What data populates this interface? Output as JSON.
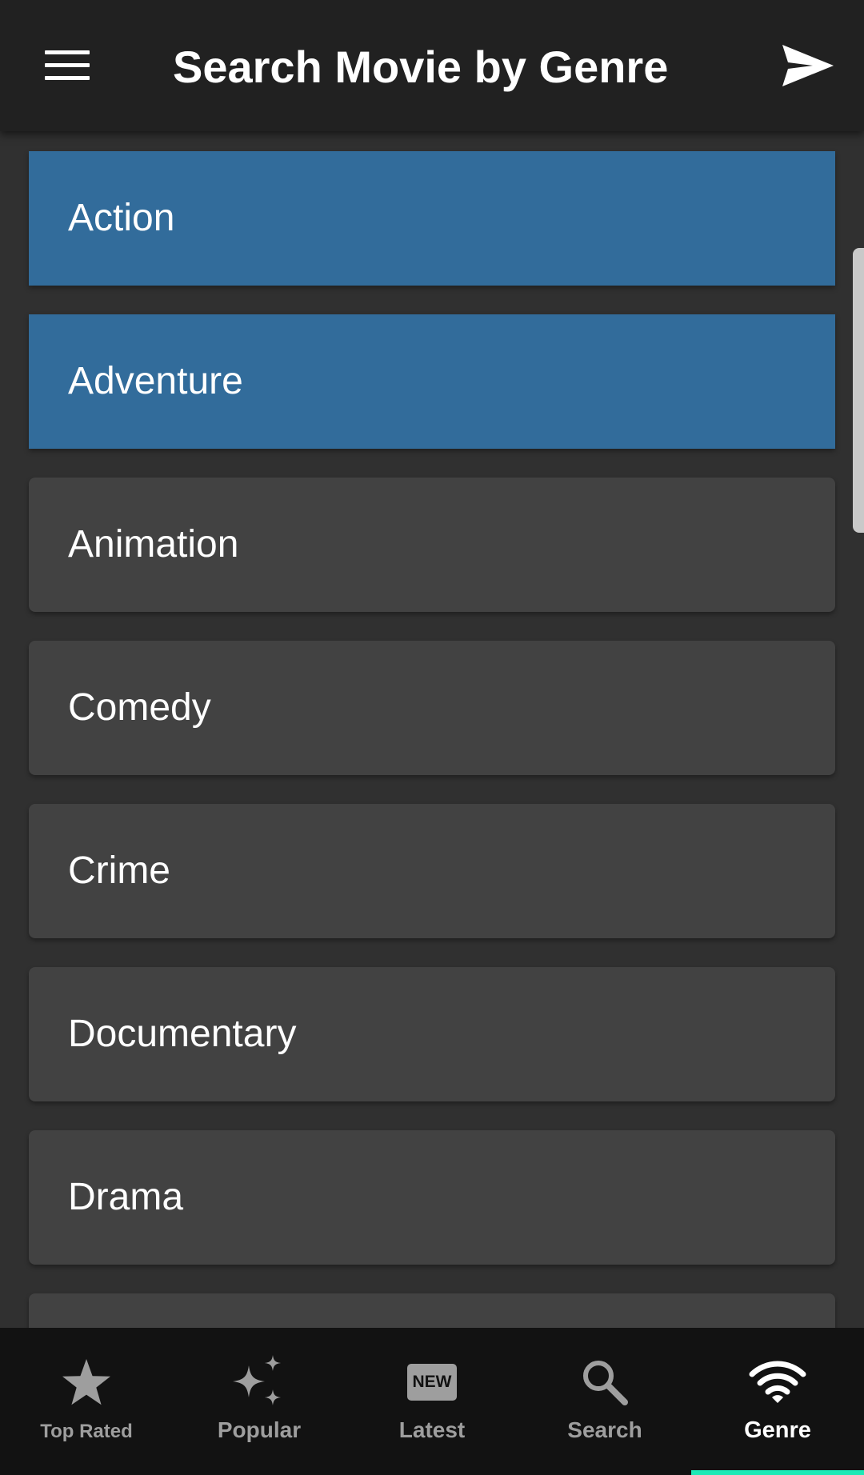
{
  "app_bar": {
    "title": "Search Movie by Genre",
    "menu_icon": "hamburger-menu-icon",
    "send_icon": "send-icon"
  },
  "genres": [
    {
      "label": "Action",
      "selected": true
    },
    {
      "label": "Adventure",
      "selected": true
    },
    {
      "label": "Animation",
      "selected": false
    },
    {
      "label": "Comedy",
      "selected": false
    },
    {
      "label": "Crime",
      "selected": false
    },
    {
      "label": "Documentary",
      "selected": false
    },
    {
      "label": "Drama",
      "selected": false
    }
  ],
  "bottom_nav": {
    "items": [
      {
        "label": "Top Rated",
        "icon": "star-icon"
      },
      {
        "label": "Popular",
        "icon": "sparkle-icon"
      },
      {
        "label": "Latest",
        "icon": "new-badge-icon",
        "badge_text": "NEW"
      },
      {
        "label": "Search",
        "icon": "search-icon"
      },
      {
        "label": "Genre",
        "icon": "wifi-icon",
        "active": true
      }
    ]
  },
  "colors": {
    "background": "#303030",
    "app_bar": "#212121",
    "card": "#424242",
    "selected_card": "#326c9b",
    "bottom_nav": "#121212",
    "accent_indicator": "#1de9b6",
    "inactive_nav": "#9e9e9e"
  }
}
